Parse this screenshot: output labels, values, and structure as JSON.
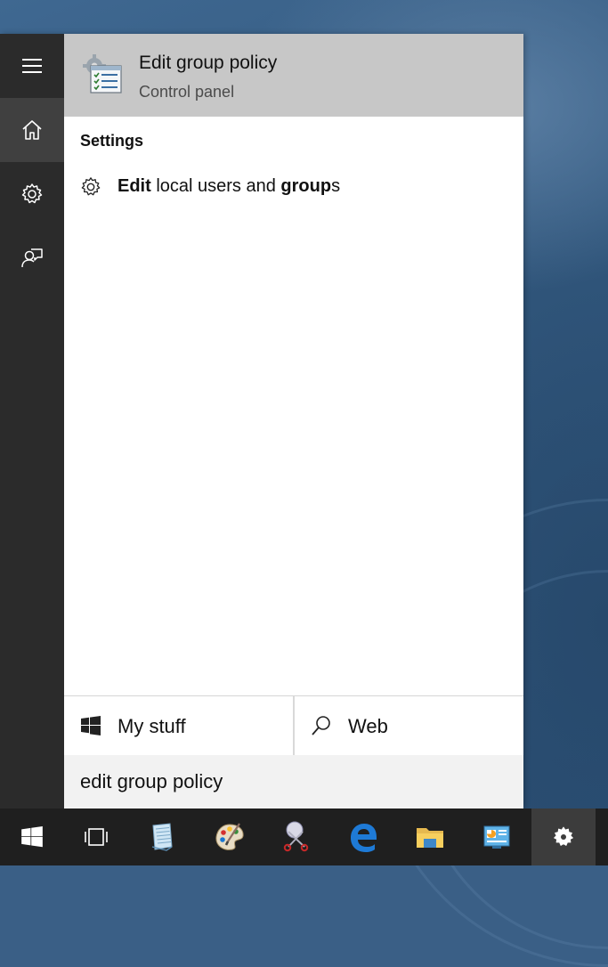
{
  "rail": {
    "items": [
      {
        "name": "menu-icon"
      },
      {
        "name": "home-icon"
      },
      {
        "name": "settings-icon"
      },
      {
        "name": "feedback-icon"
      }
    ]
  },
  "top_result": {
    "title": "Edit group policy",
    "subtitle": "Control panel",
    "icon": "group-policy-editor-icon"
  },
  "settings_section": {
    "header": "Settings",
    "item": {
      "bold_1": "Edit",
      "plain_1": " local users and ",
      "bold_2": "group",
      "plain_2": "s",
      "icon": "gear-icon"
    }
  },
  "filters": {
    "my_stuff_label": "My stuff",
    "web_label": "Web"
  },
  "search": {
    "value": "edit group policy"
  },
  "taskbar": {
    "items": [
      "windows-start-icon",
      "task-view-icon",
      "notepad-icon",
      "paint-icon",
      "snipping-tool-icon",
      "edge-icon",
      "file-explorer-icon",
      "control-panel-icon",
      "settings-icon"
    ]
  },
  "colors": {
    "rail_bg": "#2b2b2b",
    "selected_result_bg": "#c7c7c7",
    "taskbar_bg": "#1f1f1f",
    "edge_blue": "#1e7ad6"
  }
}
